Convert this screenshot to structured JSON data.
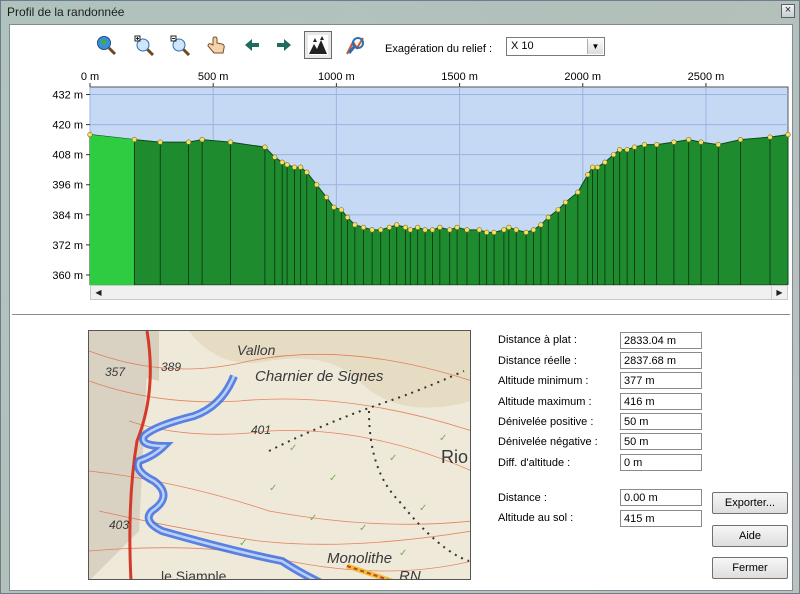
{
  "window": {
    "title": "Profil de la randonnée",
    "close_glyph": "×"
  },
  "toolbar": {
    "icons": [
      "zoom-globe-icon",
      "zoom-in-icon",
      "zoom-out-icon",
      "hand-pan-icon",
      "arrow-left-icon",
      "arrow-right-icon",
      "relief-forest-icon",
      "profile-zoom-icon"
    ],
    "relief_label": "Exagération du relief :",
    "relief_value": "X 10"
  },
  "chart_data": {
    "type": "area",
    "x_ticks": [
      "0 m",
      "500 m",
      "1000 m",
      "1500 m",
      "2000 m",
      "2500 m"
    ],
    "y_ticks": [
      "432 m",
      "420 m",
      "408 m",
      "396 m",
      "384 m",
      "372 m",
      "360 m"
    ],
    "xlim": [
      0,
      2833
    ],
    "ylim": [
      356,
      435
    ],
    "grid": true,
    "colors": {
      "sky": "#c5d9f5",
      "terrain": "#1e8c2e",
      "terrain_start": "#2ecc40",
      "point": "#f2e26b",
      "grid": "#9bb3e0"
    },
    "x": [
      0,
      180,
      285,
      400,
      455,
      570,
      710,
      750,
      780,
      800,
      830,
      855,
      880,
      920,
      960,
      990,
      1020,
      1045,
      1075,
      1110,
      1145,
      1180,
      1215,
      1245,
      1280,
      1300,
      1330,
      1360,
      1390,
      1420,
      1460,
      1490,
      1530,
      1580,
      1610,
      1640,
      1680,
      1700,
      1730,
      1770,
      1800,
      1830,
      1860,
      1900,
      1930,
      1980,
      2020,
      2040,
      2060,
      2090,
      2125,
      2150,
      2180,
      2210,
      2250,
      2300,
      2370,
      2430,
      2480,
      2550,
      2640,
      2760,
      2833
    ],
    "y": [
      416,
      414,
      413,
      413,
      414,
      413,
      411,
      407,
      405,
      404,
      403,
      403,
      401,
      396,
      391,
      387,
      386,
      383,
      380,
      379,
      378,
      378,
      379,
      380,
      379,
      378,
      379,
      378,
      378,
      379,
      378,
      379,
      378,
      378,
      377,
      377,
      378,
      379,
      378,
      377,
      378,
      380,
      383,
      386,
      389,
      393,
      400,
      403,
      403,
      405,
      408,
      410,
      410,
      411,
      412,
      412,
      413,
      414,
      413,
      412,
      414,
      415,
      416
    ]
  },
  "stats": [
    {
      "label": "Distance à plat :",
      "value": "2833.04 m"
    },
    {
      "label": "Distance réelle :",
      "value": "2837.68 m"
    },
    {
      "label": "Altitude minimum :",
      "value": "377 m"
    },
    {
      "label": "Altitude maximum :",
      "value": "416 m"
    },
    {
      "label": "Dénivelée positive :",
      "value": "50 m"
    },
    {
      "label": "Dénivelée négative :",
      "value": "50 m"
    },
    {
      "label": "Diff. d'altitude :",
      "value": "0 m"
    }
  ],
  "cursor": [
    {
      "label": "Distance :",
      "value": "0.00 m"
    },
    {
      "label": "Altitude au sol :",
      "value": "415 m"
    }
  ],
  "buttons": {
    "export": "Exporter...",
    "help": "Aide",
    "close": "Fermer"
  },
  "map": {
    "labels": [
      "357",
      "389",
      "Vallon",
      "Charnier de Signes",
      "401",
      "Rio",
      "403",
      "Monolithe",
      "RN",
      "le Siample"
    ]
  }
}
